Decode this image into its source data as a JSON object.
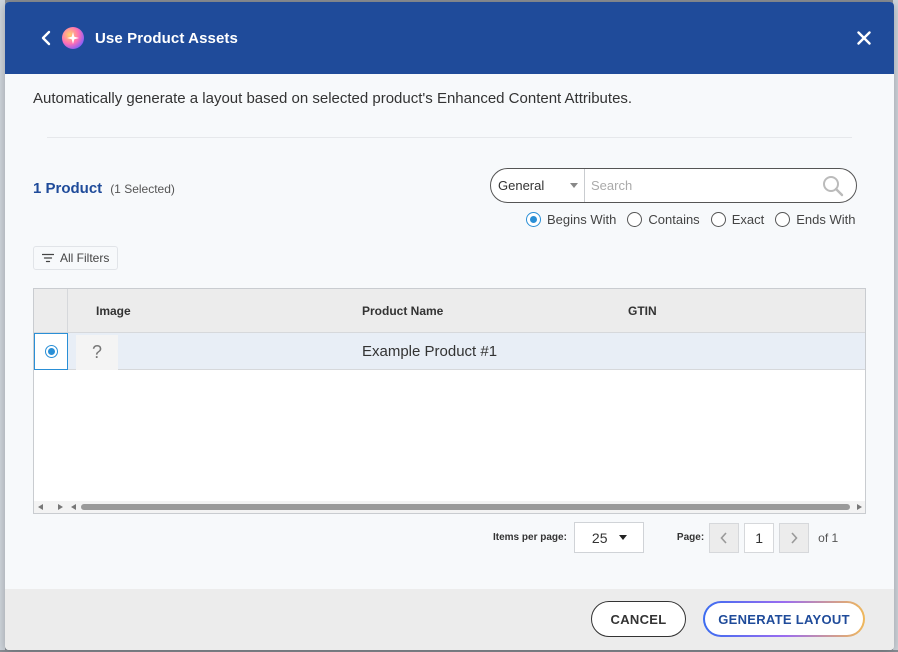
{
  "dialog": {
    "title": "Use Product Assets",
    "description": "Automatically generate a layout based on selected product's Enhanced Content Attributes."
  },
  "summary": {
    "count_label": "1 Product",
    "selected_label": "(1 Selected)"
  },
  "search": {
    "scope_value": "General",
    "placeholder": "Search",
    "value": "",
    "match_options": [
      {
        "label": "Begins With",
        "selected": true
      },
      {
        "label": "Contains",
        "selected": false
      },
      {
        "label": "Exact",
        "selected": false
      },
      {
        "label": "Ends With",
        "selected": false
      }
    ]
  },
  "filters": {
    "label": "All Filters"
  },
  "table": {
    "columns": [
      "Image",
      "Product Name",
      "GTIN"
    ],
    "rows": [
      {
        "image": "?",
        "product_name": "Example Product #1",
        "gtin": "",
        "selected": true
      }
    ]
  },
  "pagination": {
    "items_per_page_label": "Items per page:",
    "items_per_page_value": "25",
    "page_label": "Page:",
    "current_page": "1",
    "total_label": "of 1"
  },
  "footer": {
    "cancel_label": "CANCEL",
    "generate_label": "GENERATE LAYOUT"
  },
  "colors": {
    "header_bg": "#1f4b9a",
    "accent": "#2a8fd6",
    "row_selected_bg": "#e8eef6"
  }
}
